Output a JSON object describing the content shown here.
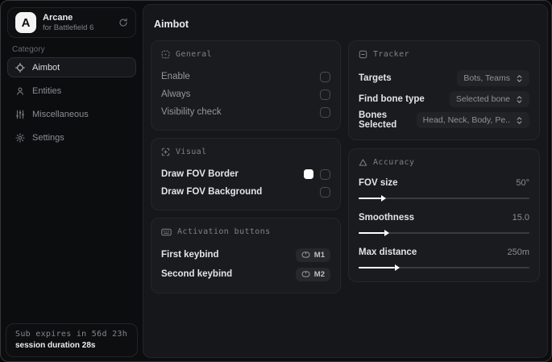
{
  "sidebar": {
    "logo_letter": "A",
    "app_name": "Arcane",
    "app_subtitle": "for Battlefield 6",
    "category_label": "Category",
    "items": [
      {
        "label": "Aimbot"
      },
      {
        "label": "Entities"
      },
      {
        "label": "Miscellaneous"
      },
      {
        "label": "Settings"
      }
    ],
    "subscription": {
      "expires_text": "Sub expires in 56d 23h",
      "session_text": "session duration 28s"
    }
  },
  "main": {
    "title": "Aimbot",
    "cards": {
      "general": {
        "title": "General",
        "rows": [
          {
            "label": "Enable",
            "checked": false
          },
          {
            "label": "Always",
            "checked": false
          },
          {
            "label": "Visibility check",
            "checked": false
          }
        ]
      },
      "visual": {
        "title": "Visual",
        "rows": [
          {
            "label": "Draw FOV Border",
            "swatch_color": "#ffffff",
            "checked": false
          },
          {
            "label": "Draw FOV Background",
            "checked": false
          }
        ]
      },
      "activation": {
        "title": "Activation buttons",
        "rows": [
          {
            "label": "First keybind",
            "key": "M1"
          },
          {
            "label": "Second keybind",
            "key": "M2"
          }
        ]
      },
      "tracker": {
        "title": "Tracker",
        "rows": [
          {
            "label": "Targets",
            "value": "Bots, Teams"
          },
          {
            "label": "Find bone type",
            "value": "Selected bone"
          },
          {
            "label": "Bones Selected",
            "value": "Head, Neck, Body, Pe.."
          }
        ]
      },
      "accuracy": {
        "title": "Accuracy",
        "sliders": [
          {
            "label": "FOV size",
            "value": "50°",
            "fill": "13%"
          },
          {
            "label": "Smoothness",
            "value": "15.0",
            "fill": "15%"
          },
          {
            "label": "Max distance",
            "value": "250m",
            "fill": "21%"
          }
        ]
      }
    }
  }
}
